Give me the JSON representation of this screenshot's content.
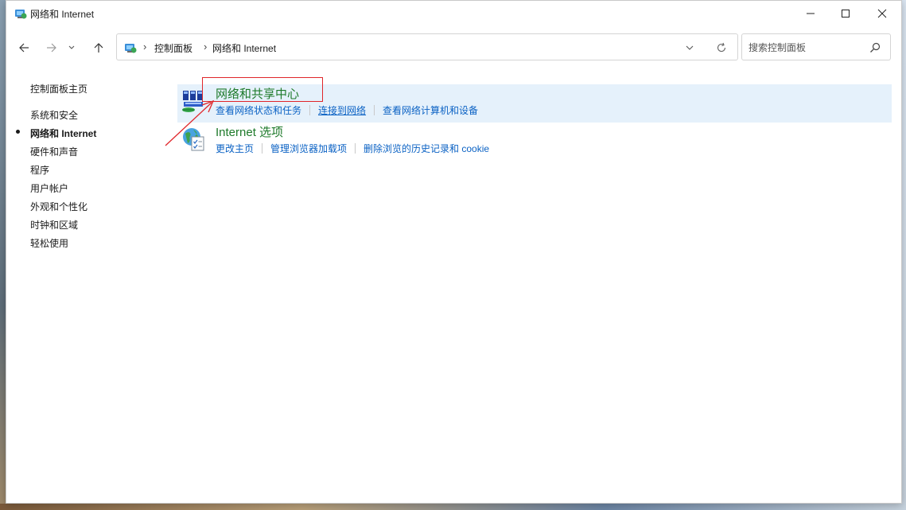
{
  "window": {
    "title": "网络和 Internet"
  },
  "address_bar": {
    "crumbs": [
      "控制面板",
      "网络和 Internet"
    ]
  },
  "search": {
    "placeholder": "搜索控制面板"
  },
  "sidebar": {
    "items": [
      {
        "label": "控制面板主页",
        "active": false
      },
      {
        "label": "系统和安全",
        "active": false
      },
      {
        "label": "网络和 Internet",
        "active": true
      },
      {
        "label": "硬件和声音",
        "active": false
      },
      {
        "label": "程序",
        "active": false
      },
      {
        "label": "用户帐户",
        "active": false
      },
      {
        "label": "外观和个性化",
        "active": false
      },
      {
        "label": "时钟和区域",
        "active": false
      },
      {
        "label": "轻松使用",
        "active": false
      }
    ]
  },
  "categories": [
    {
      "title": "网络和共享中心",
      "icon": "network-sharing-center-icon",
      "highlighted": true,
      "links": [
        "查看网络状态和任务",
        "连接到网络",
        "查看网络计算机和设备"
      ]
    },
    {
      "title": "Internet 选项",
      "icon": "internet-options-icon",
      "highlighted": false,
      "links": [
        "更改主页",
        "管理浏览器加载项",
        "删除浏览的历史记录和 cookie"
      ]
    }
  ],
  "colors": {
    "category_title": "#1e7a2a",
    "link": "#0b62c4",
    "highlight_bg": "#e5f1fb",
    "annotation": "#e0262a"
  }
}
